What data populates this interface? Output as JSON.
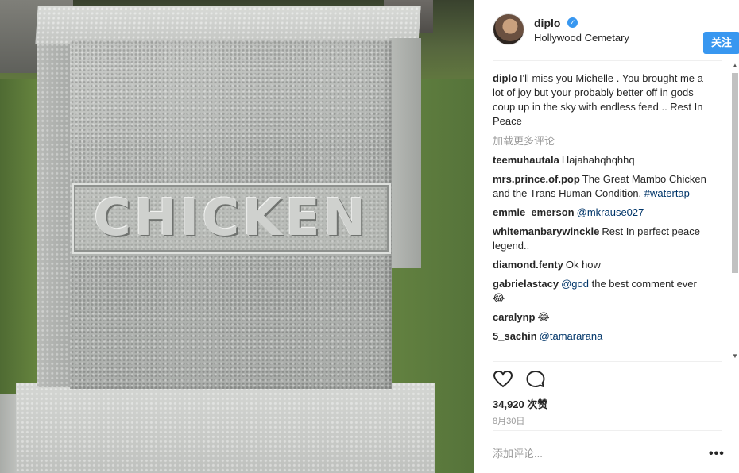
{
  "post": {
    "username": "diplo",
    "verified_icon": "verified-badge-icon",
    "location": "Hollywood Cemetary",
    "follow_label": "关注",
    "image_text": "CHICKEN"
  },
  "caption": {
    "username": "diplo",
    "text": "I'll miss you Michelle . You brought me a lot of joy but your probably better off in gods coup up in the sky with endless feed .. Rest In Peace"
  },
  "load_more_label": "加载更多评论",
  "comments": [
    {
      "user": "teemuhautala",
      "text": "Hajahahqhqhhq"
    },
    {
      "user": "mrs.prince.of.pop",
      "text": "The Great Mambo Chicken and the Trans Human Condition.",
      "tag": "#watertap"
    },
    {
      "user": "emmie_emerson",
      "mention": "@mkrause027"
    },
    {
      "user": "whitemanbarywinckle",
      "text": "Rest In perfect peace legend.."
    },
    {
      "user": "diamond.fenty",
      "text": "Ok how"
    },
    {
      "user": "gabrielastacy",
      "mention": "@god",
      "text": "the best comment ever 😂"
    },
    {
      "user": "caralynp",
      "text": "😂"
    },
    {
      "user": "5_sachin",
      "mention": "@tamararana"
    }
  ],
  "actions": {
    "like_icon": "heart-icon",
    "comment_icon": "comment-icon"
  },
  "likes_label": "34,920 次赞",
  "date_label": "8月30日",
  "add_comment_placeholder": "添加评论...",
  "more_icon": "•••",
  "colors": {
    "accent": "#3897f0",
    "mention": "#003569",
    "muted": "#999999"
  }
}
